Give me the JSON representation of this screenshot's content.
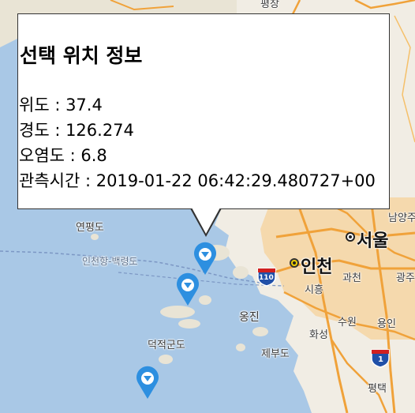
{
  "map": {
    "place_labels": {
      "seoul": "서울",
      "incheon": "인천",
      "yeonpyeongdo": "연평도",
      "deokjeok": "덕적군도",
      "ongjin": "옹진",
      "jebudo": "제부도",
      "hwaseong": "화성",
      "suwon": "수원",
      "yongin": "용인",
      "pyeongtaek": "평택",
      "siheung": "시흥",
      "gwacheon": "과천",
      "gwangju": "광주",
      "namyangju": "남양주",
      "pyeong_top": "평창",
      "sea_route": "인천항-백령도"
    },
    "shield_110": "110",
    "shield_1": "1",
    "markers": [
      {
        "name": "measurement-marker-1",
        "color": "#2d8fe0"
      },
      {
        "name": "measurement-marker-2",
        "color": "#2d8fe0"
      },
      {
        "name": "measurement-marker-3",
        "color": "#2d8fe0"
      }
    ]
  },
  "popup": {
    "title": "선택 위치 정보",
    "latitude": "위도 : 37.4",
    "longitude": "경도 : 126.274",
    "pollution": "오염도 : 6.8",
    "observed_time": "관측시간 : 2019-01-22 06:42:29.480727+00"
  }
}
